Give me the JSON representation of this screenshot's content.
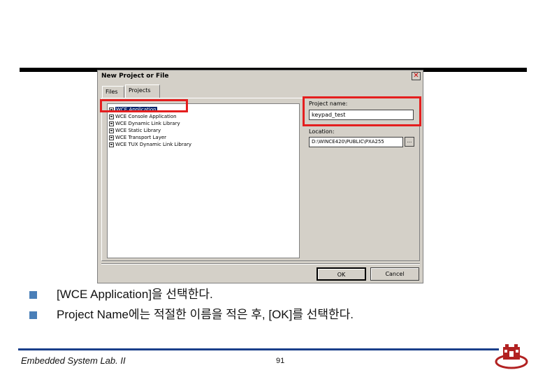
{
  "dialog": {
    "title": "New Project or File",
    "close_glyph": "✕",
    "tabs": [
      {
        "label": "Files"
      },
      {
        "label": "Projects"
      }
    ],
    "project_types": [
      {
        "label": "WCE Application",
        "selected": true
      },
      {
        "label": "WCE Console Application",
        "selected": false
      },
      {
        "label": "WCE Dynamic Link Library",
        "selected": false
      },
      {
        "label": "WCE Static Library",
        "selected": false
      },
      {
        "label": "WCE Transport Layer",
        "selected": false
      },
      {
        "label": "WCE TUX Dynamic Link Library",
        "selected": false
      }
    ],
    "project_name_label": "Project name:",
    "project_name_value": "keypad_test",
    "location_label": "Location:",
    "location_value": "D:\\WINCE420\\PUBLIC\\PXA255",
    "browse_label": "...",
    "ok_label": "OK",
    "cancel_label": "Cancel"
  },
  "bullets": [
    {
      "text": "[WCE Application]을 선택한다."
    },
    {
      "text": "Project Name에는 적절한 이름을 적은 후, [OK]를 선택한다."
    }
  ],
  "footer": {
    "lab_name": "Embedded System Lab. II",
    "page_number": "91"
  },
  "colors": {
    "highlight_frame": "#e41e1e",
    "bullet": "#4a7fb8",
    "footer_rule": "#1a3f8a",
    "dialog_face": "#d4d0c8",
    "selection": "#0a246a"
  }
}
